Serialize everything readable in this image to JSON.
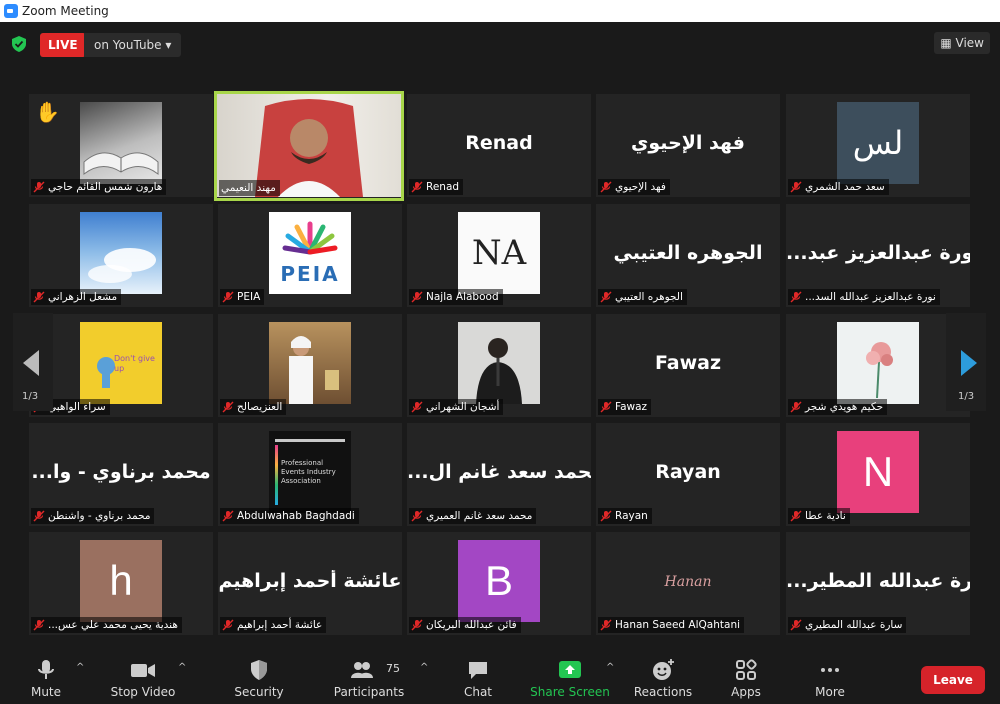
{
  "window": {
    "title": "Zoom Meeting"
  },
  "topbar": {
    "live_label": "LIVE",
    "stream_label": "on YouTube",
    "view_label": "View"
  },
  "tiles": [
    {
      "name": "هارون شمس القائم حاجي",
      "hand_raised": true,
      "kind": "image-book"
    },
    {
      "name": "مهند النعيمي",
      "active_speaker": true,
      "kind": "image-person"
    },
    {
      "name": "Renad",
      "display": "Renad",
      "kind": "text"
    },
    {
      "name": "فهد الإحيوي",
      "display": "فهد الإحيوي",
      "kind": "text"
    },
    {
      "name": "سعد حمد الشمري",
      "kind": "image-logo",
      "logo_text": "لس"
    },
    {
      "name": "مشعل الزهراني",
      "kind": "image-sky"
    },
    {
      "name": "PEIA",
      "kind": "image-peia",
      "logo_text": "PEIA"
    },
    {
      "name": "Najla Alabood",
      "kind": "image-na",
      "logo_text": "NA"
    },
    {
      "name": "الجوهره العتيبي",
      "display": "الجوهره العتيبي",
      "kind": "text"
    },
    {
      "name": "...نورة عبدالعزيز عبدالله السد",
      "display": "...نورة عبدالعزيز عبد",
      "kind": "text"
    },
    {
      "name": "سراء الواهبي",
      "kind": "image-yellow",
      "logo_text": "Don't give up"
    },
    {
      "name": "العنزيصالح",
      "kind": "image-person2"
    },
    {
      "name": "أشجان الشهراني",
      "kind": "image-person3"
    },
    {
      "name": "Fawaz",
      "display": "Fawaz",
      "kind": "text"
    },
    {
      "name": "حكيم هويدي شجر",
      "kind": "image-flower"
    },
    {
      "name": "محمد برناوي - واشنطن",
      "display": "...محمد برناوي - وا",
      "kind": "text"
    },
    {
      "name": "Abdulwahab Baghdadi",
      "kind": "image-assoc",
      "logo_text": "Professional Events Industry Association"
    },
    {
      "name": "محمد سعد غانم العميري",
      "display": "...محمد سعد غانم ال",
      "kind": "text"
    },
    {
      "name": "Rayan",
      "display": "Rayan",
      "kind": "text"
    },
    {
      "name": "نادية عطا",
      "kind": "letter",
      "letter": "N",
      "color": "#e8407c"
    },
    {
      "name": "...هندية يحيى محمد علي عس",
      "kind": "letter",
      "letter": "h",
      "color": "#9a7060"
    },
    {
      "name": "عائشة أحمد إبراهيم",
      "display": "عائشة أحمد إبراهيم",
      "kind": "text"
    },
    {
      "name": "فائن عبدالله البريكان",
      "kind": "letter",
      "letter": "B",
      "color": "#a347c4"
    },
    {
      "name": "Hanan Saeed AlQahtani",
      "display": "Hanan",
      "kind": "script"
    },
    {
      "name": "سارة عبدالله المطيري",
      "display": "...سارة عبدالله المطير",
      "kind": "text"
    }
  ],
  "pagination": {
    "left_page": "1/3",
    "right_page": "1/3"
  },
  "toolbar": {
    "mute": "Mute",
    "stop_video": "Stop Video",
    "security": "Security",
    "participants": "Participants",
    "participants_count": "75",
    "chat": "Chat",
    "share_screen": "Share Screen",
    "reactions": "Reactions",
    "apps": "Apps",
    "more": "More",
    "leave": "Leave"
  },
  "colors": {
    "accent_green": "#23c552",
    "leave_red": "#d6232a",
    "live_red": "#e02828",
    "active_border": "#a8d64a"
  }
}
